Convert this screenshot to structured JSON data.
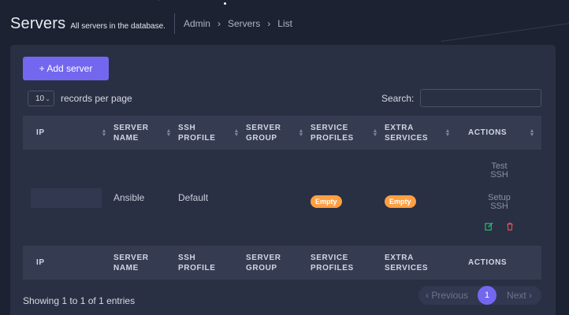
{
  "header": {
    "title": "Servers",
    "subtitle": "All servers in the database.",
    "breadcrumb": [
      "Admin",
      "Servers",
      "List"
    ]
  },
  "toolbar": {
    "add_label": "+ Add server",
    "page_length": "10",
    "page_length_suffix": "records per page",
    "search_label": "Search:",
    "search_value": ""
  },
  "table": {
    "columns": [
      "IP",
      "SERVER NAME",
      "SSH PROFILE",
      "SERVER GROUP",
      "SERVICE PROFILES",
      "EXTRA SERVICES",
      "ACTIONS"
    ],
    "rows": [
      {
        "ip": "",
        "server_name": "Ansible",
        "ssh_profile": "Default",
        "server_group": "",
        "service_profiles": "Empty",
        "extra_services": "Empty",
        "actions": {
          "test_ssh": "Test SSH",
          "setup_ssh": "Setup SSH"
        }
      }
    ]
  },
  "footer": {
    "info": "Showing 1 to 1 of 1 entries",
    "prev": "Previous",
    "current_page": "1",
    "next": "Next"
  },
  "colors": {
    "accent": "#7367f0",
    "badge": "#ff9f43",
    "edit": "#28c76f",
    "delete": "#ea5455"
  }
}
